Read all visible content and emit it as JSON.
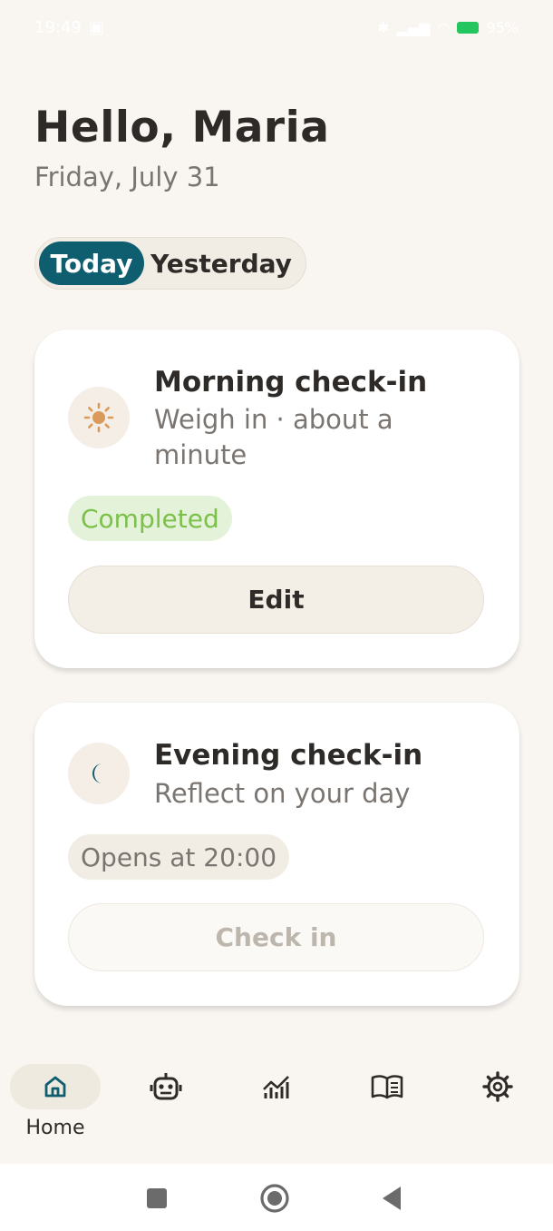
{
  "status_bar": {
    "time": "19:49",
    "battery": "95%"
  },
  "header": {
    "greeting": "Hello, Maria",
    "date": "Friday, July 31"
  },
  "tabs": [
    {
      "label": "Today",
      "active": true
    },
    {
      "label": "Yesterday",
      "active": false
    }
  ],
  "cards": {
    "morning": {
      "icon": "sun-icon",
      "title": "Morning check-in",
      "subtitle_line1": "Weigh in · about a",
      "subtitle_line2": "minute",
      "status": "Completed",
      "button_label": "Edit"
    },
    "evening": {
      "icon": "moon-icon",
      "title": "Evening check-in",
      "subtitle": "Reflect on your day",
      "status": "Opens at 20:00",
      "button_label": "Check in"
    }
  },
  "bottom_nav": {
    "items": [
      {
        "icon": "home-icon",
        "label": "Home",
        "active": true
      },
      {
        "icon": "robot-icon",
        "label": ""
      },
      {
        "icon": "chart-icon",
        "label": ""
      },
      {
        "icon": "book-icon",
        "label": ""
      },
      {
        "icon": "gear-icon",
        "label": ""
      }
    ]
  },
  "colors": {
    "accent": "#0e5e6f",
    "background": "#f9f6f1",
    "completed_text": "#7cc04a",
    "completed_bg": "#e3f2d9",
    "sun": "#d99a5b"
  }
}
